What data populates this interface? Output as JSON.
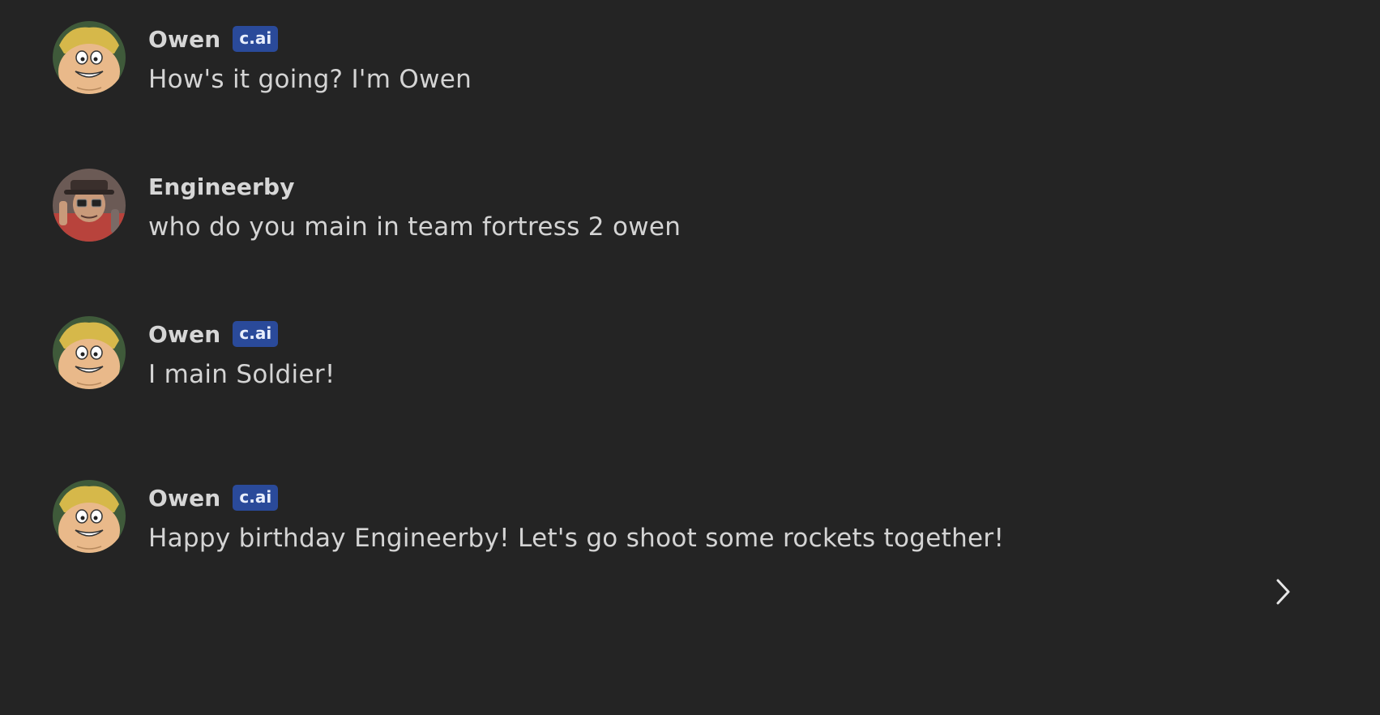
{
  "messages": [
    {
      "author": "Owen",
      "badge": "c.ai",
      "avatar": "owen-avatar",
      "text": "How's it going? I'm Owen"
    },
    {
      "author": "Engineerby",
      "badge": "",
      "avatar": "engineerby-avatar",
      "text": "who do you main in team fortress 2 owen"
    },
    {
      "author": "Owen",
      "badge": "c.ai",
      "avatar": "owen-avatar",
      "text": "I main Soldier!"
    },
    {
      "author": "Owen",
      "badge": "c.ai",
      "avatar": "owen-avatar",
      "text": "Happy birthday Engineerby! Let's go shoot some rockets together!"
    }
  ],
  "controls": {
    "next_icon": "chevron-right-icon"
  },
  "colors": {
    "background": "#242424",
    "badge": "#2a4a9a",
    "text": "#d4d4d4"
  }
}
